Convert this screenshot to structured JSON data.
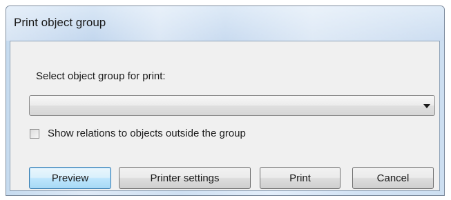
{
  "window": {
    "title": "Print object group"
  },
  "form": {
    "select_label": "Select object group for print:",
    "object_group_value": "",
    "show_relations_label": "Show relations to objects outside the group",
    "show_relations_checked": false
  },
  "buttons": {
    "preview": "Preview",
    "printer_settings": "Printer settings",
    "print": "Print",
    "cancel": "Cancel"
  },
  "icons": {
    "dropdown": "chevron-down-icon",
    "checkbox": "checkbox-unchecked-icon"
  },
  "colors": {
    "default_button_border": "#3c7fb1",
    "default_button_fill": "#bee6fd",
    "titlebar": "#c3d7ee",
    "client_background": "#f0f0f0"
  }
}
